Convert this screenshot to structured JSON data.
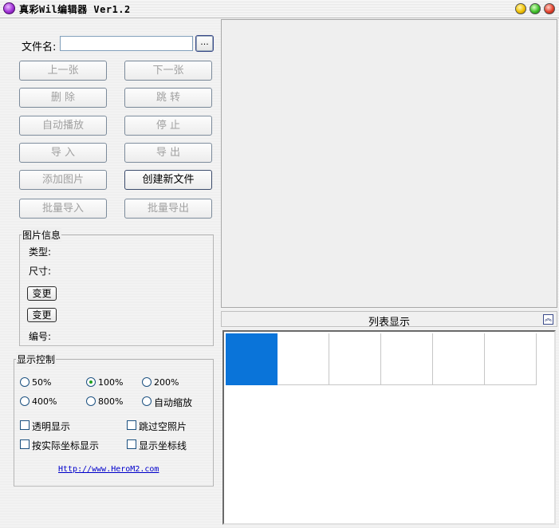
{
  "window": {
    "title": "真彩Wil编辑器 Ver1.2"
  },
  "file": {
    "label": "文件名:",
    "value": "",
    "browse_label": "..."
  },
  "buttons": {
    "prev": "上一张",
    "next": "下一张",
    "delete": "删  除",
    "jump": "跳  转",
    "autoplay": "自动播放",
    "stop": "停  止",
    "import": "导  入",
    "export": "导  出",
    "add_image": "添加图片",
    "create_new": "创建新文件",
    "batch_import": "批量导入",
    "batch_export": "批量导出"
  },
  "image_info": {
    "title": "图片信息",
    "type_label": "类型:",
    "size_label": "尺寸:",
    "change1": "变更",
    "change2": "变更",
    "number_label": "编号:"
  },
  "display": {
    "title": "显示控制",
    "zoom_options": [
      "50%",
      "100%",
      "200%",
      "400%",
      "800%",
      "自动缩放"
    ],
    "zoom_selected": "100%",
    "checkboxes": [
      "透明显示",
      "跳过空照片",
      "按实际坐标显示",
      "显示坐标线"
    ],
    "link": "Http://www.HeroM2.com"
  },
  "list": {
    "title": "列表显示",
    "collapse_icon": "double-chevron-up-icon"
  },
  "colors": {
    "selection": "#0a74d9"
  }
}
